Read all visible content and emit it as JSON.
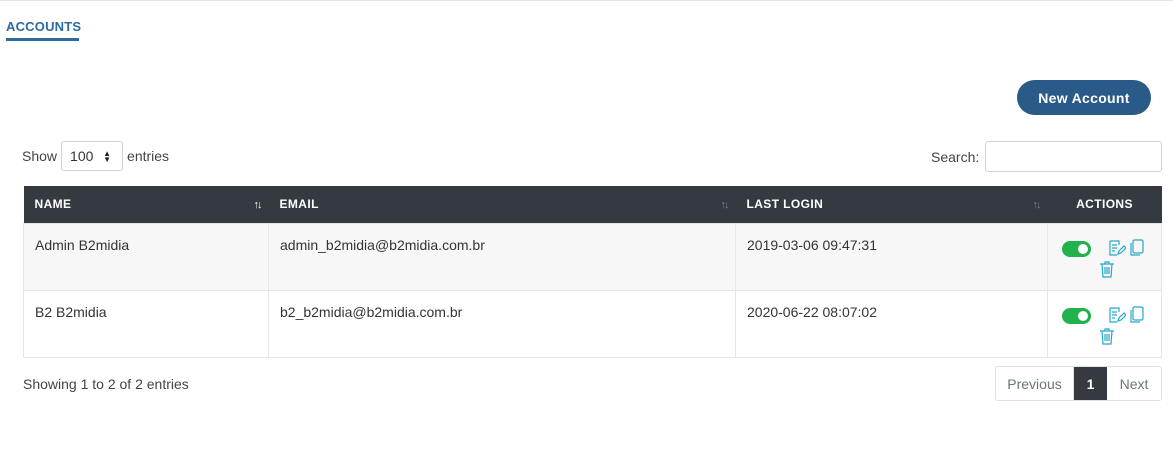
{
  "tabs": {
    "accounts_label": "ACCOUNTS"
  },
  "toolbar": {
    "new_account_label": "New Account"
  },
  "length_control": {
    "show_label": "Show",
    "value": "100",
    "entries_label": "entries"
  },
  "search": {
    "label": "Search:",
    "value": ""
  },
  "table": {
    "columns": [
      "NAME",
      "EMAIL",
      "LAST LOGIN",
      "ACTIONS"
    ],
    "rows": [
      {
        "name": "Admin B2midia",
        "email": "admin_b2midia@b2midia.com.br",
        "last_login": "2019-03-06 09:47:31",
        "active": true
      },
      {
        "name": "B2 B2midia",
        "email": "b2_b2midia@b2midia.com.br",
        "last_login": "2020-06-22 08:07:02",
        "active": true
      }
    ]
  },
  "footer": {
    "info": "Showing 1 to 2 of 2 entries",
    "pagination": {
      "previous": "Previous",
      "current": "1",
      "next": "Next"
    }
  },
  "colors": {
    "accent": "#2c6aa0",
    "button": "#2a5b88",
    "header_bg": "#343a40",
    "toggle_on": "#22b14c",
    "icon": "#2aa6c9"
  },
  "icons": {
    "sort": "sort-icon",
    "edit": "edit-icon",
    "copy": "copy-icon",
    "delete": "trash-icon",
    "toggle": "toggle-switch"
  }
}
